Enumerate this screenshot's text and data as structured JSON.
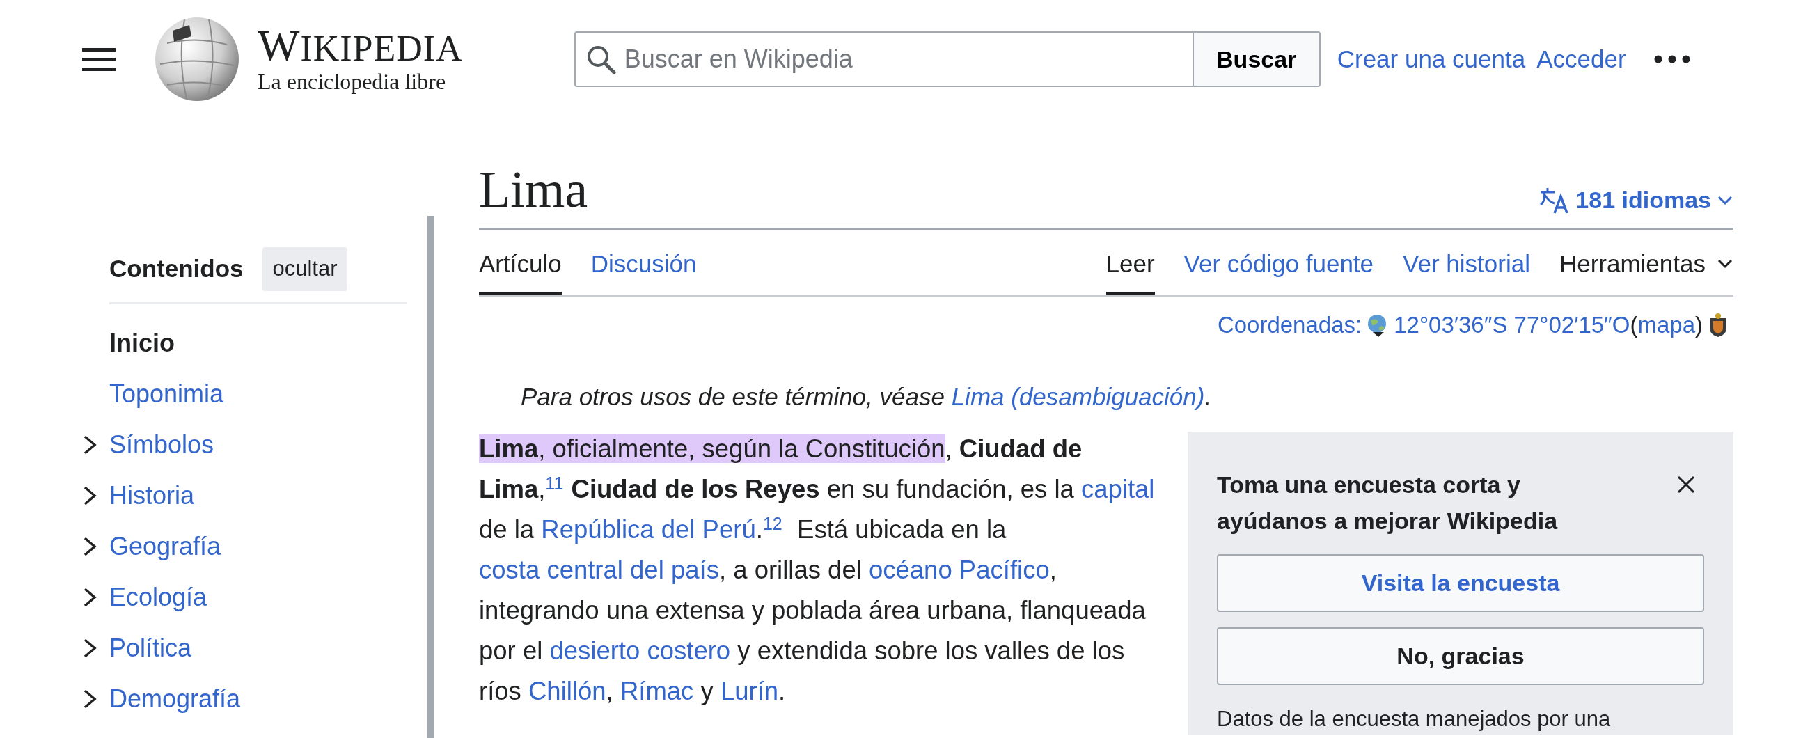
{
  "header": {
    "logo": {
      "wordmark": "WIKIPEDIA",
      "tagline": "La enciclopedia libre"
    },
    "search": {
      "placeholder": "Buscar en Wikipedia",
      "button": "Buscar"
    },
    "user_links": [
      "Crear una cuenta",
      "Acceder"
    ]
  },
  "toc": {
    "title": "Contenidos",
    "hide_button": "ocultar",
    "items": [
      {
        "label": "Inicio",
        "selected": true,
        "expandable": false
      },
      {
        "label": "Toponimia",
        "selected": false,
        "expandable": false
      },
      {
        "label": "Símbolos",
        "selected": false,
        "expandable": true
      },
      {
        "label": "Historia",
        "selected": false,
        "expandable": true
      },
      {
        "label": "Geografía",
        "selected": false,
        "expandable": true
      },
      {
        "label": "Ecología",
        "selected": false,
        "expandable": true
      },
      {
        "label": "Política",
        "selected": false,
        "expandable": true
      },
      {
        "label": "Demografía",
        "selected": false,
        "expandable": true
      }
    ]
  },
  "article": {
    "title": "Lima",
    "languages": "181 idiomas",
    "tabs_left": [
      {
        "label": "Artículo",
        "selected": true,
        "kind": "tab"
      },
      {
        "label": "Discusión",
        "selected": false,
        "kind": "tab"
      }
    ],
    "tabs_right": [
      {
        "label": "Leer",
        "selected": true,
        "kind": "tab"
      },
      {
        "label": "Ver código fuente",
        "selected": false,
        "kind": "tab"
      },
      {
        "label": "Ver historial",
        "selected": false,
        "kind": "tab"
      },
      {
        "label": "Herramientas",
        "selected": false,
        "kind": "menu"
      }
    ],
    "coordinates": [
      {
        "kind": "link",
        "text": "Coordenadas:"
      },
      {
        "kind": "globe"
      },
      {
        "kind": "link",
        "text": "12°03′36″S 77°02′15″O"
      },
      {
        "kind": "text",
        "text": " ("
      },
      {
        "kind": "link",
        "text": "mapa"
      },
      {
        "kind": "text",
        "text": ")"
      },
      {
        "kind": "emblem"
      }
    ],
    "hatnote": [
      {
        "kind": "text",
        "text": "Para otros usos de este término, véase "
      },
      {
        "kind": "link",
        "text": "Lima (desambiguación)"
      },
      {
        "kind": "text",
        "text": "."
      }
    ],
    "paragraph": [
      {
        "kind": "bold",
        "text": "Lima",
        "highlighted": true
      },
      {
        "kind": "text",
        "text": ", oficialmente, según la Constitución",
        "highlighted": true
      },
      {
        "kind": "text",
        "text": ", "
      },
      {
        "kind": "bold",
        "text": "Ciudad de Lima"
      },
      {
        "kind": "text",
        "text": ","
      },
      {
        "kind": "sup",
        "text": "11"
      },
      {
        "kind": "bold",
        "text": "Ciudad de los Reyes"
      },
      {
        "kind": "text",
        "text": " en su fundación, es la "
      },
      {
        "kind": "link",
        "text": "capital"
      },
      {
        "kind": "text",
        "text": " de la "
      },
      {
        "kind": "link",
        "text": "República del Perú"
      },
      {
        "kind": "text",
        "text": "."
      },
      {
        "kind": "sup",
        "text": "12"
      },
      {
        "kind": "text",
        "text": "  Está ubicada en la "
      },
      {
        "kind": "link",
        "text": "costa central del país"
      },
      {
        "kind": "text",
        "text": ", a orillas del "
      },
      {
        "kind": "link",
        "text": "océano Pacífico"
      },
      {
        "kind": "text",
        "text": ", integrando una extensa y poblada área urbana, flanqueada por el "
      },
      {
        "kind": "link",
        "text": "desierto costero"
      },
      {
        "kind": "text",
        "text": " y extendida sobre los valles de los ríos "
      },
      {
        "kind": "link",
        "text": "Chillón"
      },
      {
        "kind": "text",
        "text": ", "
      },
      {
        "kind": "link",
        "text": "Rímac"
      },
      {
        "kind": "text",
        "text": " y "
      },
      {
        "kind": "link",
        "text": "Lurín"
      },
      {
        "kind": "text",
        "text": "."
      }
    ]
  },
  "survey": {
    "title": "Toma una encuesta corta y ayúdanos a mejorar Wikipedia",
    "buttons": [
      {
        "label": "Visita la encuesta",
        "kind": "primary"
      },
      {
        "label": "No, gracias",
        "kind": "secondary"
      }
    ],
    "note": "Datos de la encuesta manejados por una"
  }
}
